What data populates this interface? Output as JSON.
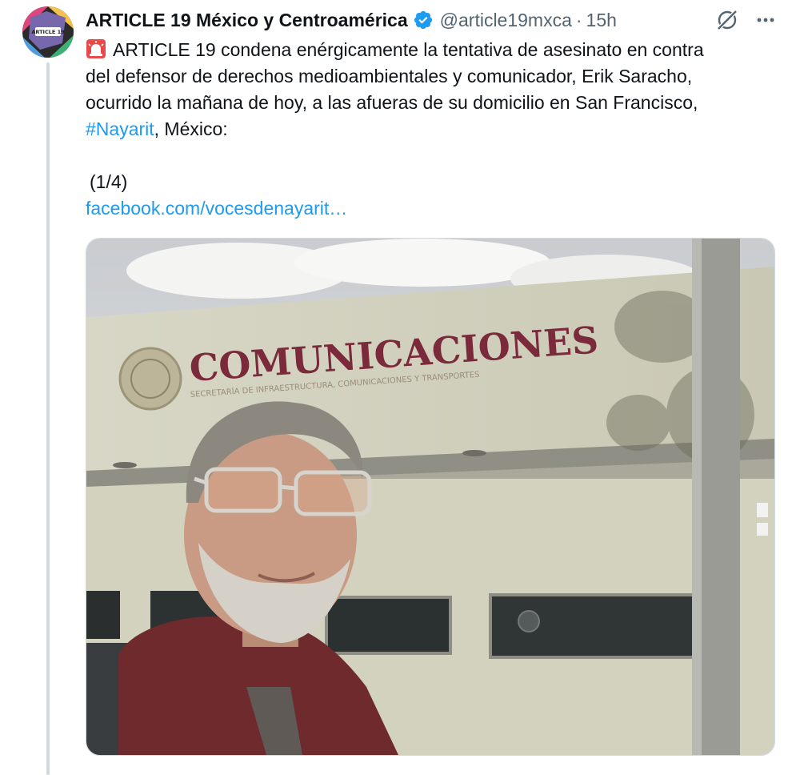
{
  "author": {
    "name": "ARTICLE 19 México y Centroamérica",
    "handle": "@article19mxca",
    "separator": "·",
    "time": "15h",
    "avatar_text": "ARTICLE 19"
  },
  "post": {
    "line1": "ARTICLE 19 condena enérgicamente la tentativa de asesinato en contra",
    "line2": "del defensor de derechos medioambientales y comunicador, Erik Saracho,",
    "line3": "ocurrido la mañana de hoy, a las afueras de su domicilio en San Francisco,",
    "hashtag": "#Nayarit",
    "line4_rest": ", México:",
    "counter": "(1/4)",
    "link": "facebook.com/vocesdenayarit…"
  },
  "photo": {
    "sign_text": "COMUNICACIONES",
    "sign_subtext": "SECRETARÍA DE INFRAESTRUCTURA, COMUNICACIONES Y TRANSPORTES"
  },
  "icons": {
    "siren": "rotating-light-icon",
    "verified": "verified-badge-icon",
    "grok": "grok-icon",
    "more": "more-icon"
  },
  "colors": {
    "accent": "#1d9bf0",
    "text": "#0f1419",
    "secondary": "#536471",
    "sign": "#7a2a3a"
  }
}
